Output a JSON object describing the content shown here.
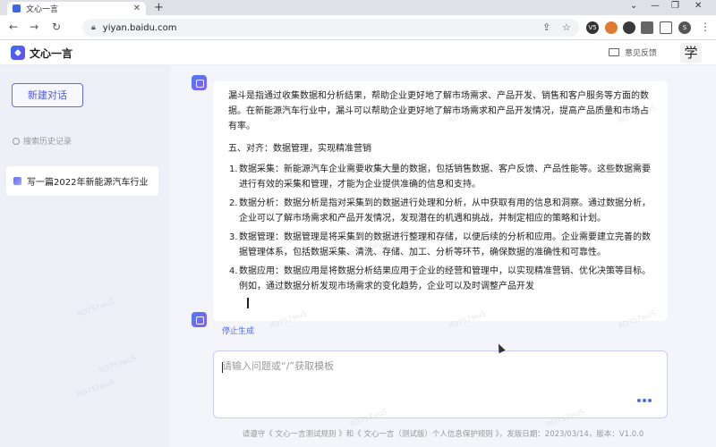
{
  "browser": {
    "tab_title": "文心一言",
    "tab_close": "✕",
    "new_tab": "+",
    "url": "yiyan.baidu.com",
    "back": "←",
    "forward": "→",
    "reload": "↻",
    "minimize": "⌄",
    "min2": "—",
    "restore": "❐",
    "close": "✕",
    "profile_initial": "S",
    "ext_label": "V5"
  },
  "header": {
    "logo_text": "文心一言",
    "feedback_label": "意见反馈",
    "badge": "学"
  },
  "sidebar": {
    "new_chat": "新建对话",
    "search_placeholder": "搜索历史记录",
    "conversations": [
      {
        "label": "写一篇2022年新能源汽车行业"
      }
    ]
  },
  "answer": {
    "intro": "漏斗是指通过收集数据和分析结果，帮助企业更好地了解市场需求、产品开发、销售和客户服务等方面的数据。在新能源汽车行业中，漏斗可以帮助企业更好地了解市场需求和产品开发情况，提高产品质量和市场占有率。",
    "section_title": "五、对齐：数据管理，实现精准营销",
    "items": [
      {
        "num": "1.",
        "text": "数据采集：新能源汽车企业需要收集大量的数据，包括销售数据、客户反馈、产品性能等。这些数据需要进行有效的采集和管理，才能为企业提供准确的信息和支持。"
      },
      {
        "num": "2.",
        "text": "数据分析：数据分析是指对采集到的数据进行处理和分析，从中获取有用的信息和洞察。通过数据分析，企业可以了解市场需求和产品开发情况，发现潜在的机遇和挑战，并制定相应的策略和计划。"
      },
      {
        "num": "3.",
        "text": "数据管理：数据管理是将采集到的数据进行整理和存储，以便后续的分析和应用。企业需要建立完善的数据管理体系，包括数据采集、清洗、存储、加工、分析等环节，确保数据的准确性和可靠性。"
      },
      {
        "num": "4.",
        "text": "数据应用：数据应用是将数据分析结果应用于企业的经营和管理中，以实现精准营销、优化决策等目标。例如，通过数据分析发现市场需求的变化趋势，企业可以及时调整产品开发"
      }
    ],
    "stop_label": "停止生成"
  },
  "input": {
    "placeholder": "请输入问题或“/”获取模板"
  },
  "footer": {
    "note": "请遵守《 文心一言测试规则 》和《 文心一言（测试版）个人信息保护规则 》，发版日期：2023/03/14，版本：V1.0.0"
  },
  "watermark_text": "RD757wuS",
  "colors": {
    "accent": "#4a6cf0",
    "sidebar_bg": "#eef0f8",
    "main_bg": "#f4f5fb"
  }
}
